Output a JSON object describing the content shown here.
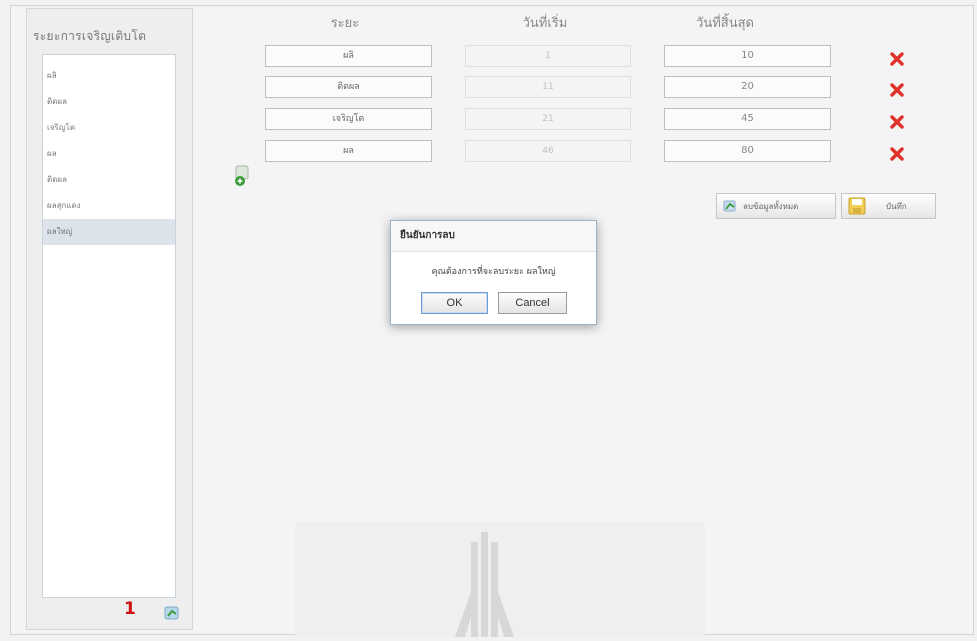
{
  "left_panel": {
    "title": "ระยะการเจริญเติบโต",
    "stages": [
      {
        "label": "ผลิ"
      },
      {
        "label": "ติดผล"
      },
      {
        "label": "เจริญโต"
      },
      {
        "label": "ผล"
      },
      {
        "label": "ติดผล"
      },
      {
        "label": "ผลสุกแดง"
      },
      {
        "label": "ผลใหญ่"
      }
    ],
    "selected_index": 6,
    "page_number": "1"
  },
  "headers": {
    "stage": "ระยะ",
    "start_day": "วันที่เริ่ม",
    "end_day": "วันที่สิ้นสุด"
  },
  "rows": [
    {
      "stage": "ผลิ",
      "start": "1",
      "end": "10"
    },
    {
      "stage": "ติดผล",
      "start": "11",
      "end": "20"
    },
    {
      "stage": "เจริญโต",
      "start": "21",
      "end": "45"
    },
    {
      "stage": "ผล",
      "start": "46",
      "end": "80"
    }
  ],
  "buttons": {
    "clear_all": "ลบข้อมูลทั้งหมด",
    "save": "บันทึก"
  },
  "dialog": {
    "title": "ยืนยันการลบ",
    "message": "คุณต้องการที่จะลบระยะ ผลใหญ่",
    "ok": "OK",
    "cancel": "Cancel"
  },
  "colors": {
    "delete": "#e0312a",
    "page_number": "#d01010",
    "icon_green": "#3a9a3a"
  },
  "icons": [
    "delete-icon",
    "add-row-icon",
    "add-stage-icon",
    "clear-icon",
    "save-icon"
  ]
}
